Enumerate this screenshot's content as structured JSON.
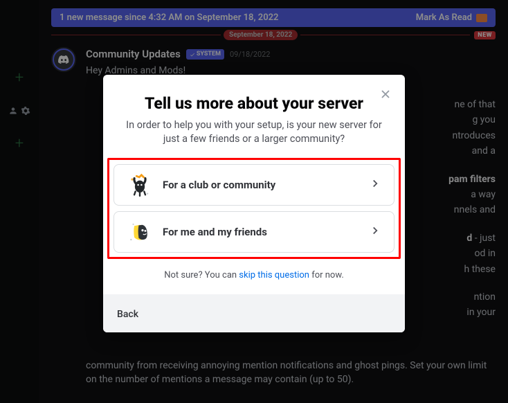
{
  "banner": {
    "text": "1 new message since 4:32 AM on September 18, 2022",
    "mark_read": "Mark As Read"
  },
  "date_divider": {
    "label": "September 18, 2022",
    "new_badge": "NEW"
  },
  "message": {
    "author": "Community Updates",
    "system_tag": "SYSTEM",
    "timestamp": "09/18/2022",
    "greeting": "Hey Admins and Mods!",
    "body_parts": {
      "p1a": "ne of that",
      "p1b": "g you",
      "p1c": "ntroduces",
      "p1d": "and a",
      "p2h": "pam filters",
      "p2a": "a way",
      "p2b": "nnels and",
      "p3h": "d",
      "p3a": " - just",
      "p3b": "od in",
      "p3c": "h these",
      "p4a": "ntion",
      "p4b": "in your",
      "p5": "community from receiving annoying mention notifications and ghost pings. Set your own limit on the number of mentions a message may contain (up to 50)."
    }
  },
  "modal": {
    "title": "Tell us more about your server",
    "subtitle": "In order to help you with your setup, is your new server for just a few friends or a larger community?",
    "options": [
      {
        "label": "For a club or community"
      },
      {
        "label": "For me and my friends"
      }
    ],
    "skip_prefix": "Not sure? You can ",
    "skip_link": "skip this question",
    "skip_suffix": " for now.",
    "back": "Back"
  }
}
